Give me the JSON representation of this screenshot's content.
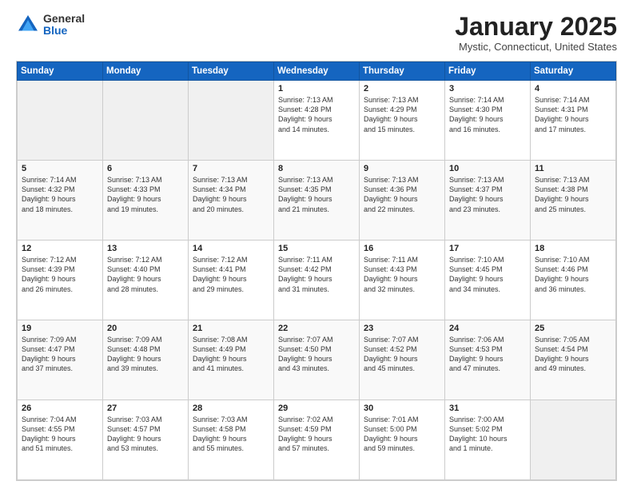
{
  "header": {
    "logo_general": "General",
    "logo_blue": "Blue",
    "month_title": "January 2025",
    "location": "Mystic, Connecticut, United States"
  },
  "days_of_week": [
    "Sunday",
    "Monday",
    "Tuesday",
    "Wednesday",
    "Thursday",
    "Friday",
    "Saturday"
  ],
  "weeks": [
    [
      {
        "day": "",
        "content": ""
      },
      {
        "day": "",
        "content": ""
      },
      {
        "day": "",
        "content": ""
      },
      {
        "day": "1",
        "content": "Sunrise: 7:13 AM\nSunset: 4:28 PM\nDaylight: 9 hours\nand 14 minutes."
      },
      {
        "day": "2",
        "content": "Sunrise: 7:13 AM\nSunset: 4:29 PM\nDaylight: 9 hours\nand 15 minutes."
      },
      {
        "day": "3",
        "content": "Sunrise: 7:14 AM\nSunset: 4:30 PM\nDaylight: 9 hours\nand 16 minutes."
      },
      {
        "day": "4",
        "content": "Sunrise: 7:14 AM\nSunset: 4:31 PM\nDaylight: 9 hours\nand 17 minutes."
      }
    ],
    [
      {
        "day": "5",
        "content": "Sunrise: 7:14 AM\nSunset: 4:32 PM\nDaylight: 9 hours\nand 18 minutes."
      },
      {
        "day": "6",
        "content": "Sunrise: 7:13 AM\nSunset: 4:33 PM\nDaylight: 9 hours\nand 19 minutes."
      },
      {
        "day": "7",
        "content": "Sunrise: 7:13 AM\nSunset: 4:34 PM\nDaylight: 9 hours\nand 20 minutes."
      },
      {
        "day": "8",
        "content": "Sunrise: 7:13 AM\nSunset: 4:35 PM\nDaylight: 9 hours\nand 21 minutes."
      },
      {
        "day": "9",
        "content": "Sunrise: 7:13 AM\nSunset: 4:36 PM\nDaylight: 9 hours\nand 22 minutes."
      },
      {
        "day": "10",
        "content": "Sunrise: 7:13 AM\nSunset: 4:37 PM\nDaylight: 9 hours\nand 23 minutes."
      },
      {
        "day": "11",
        "content": "Sunrise: 7:13 AM\nSunset: 4:38 PM\nDaylight: 9 hours\nand 25 minutes."
      }
    ],
    [
      {
        "day": "12",
        "content": "Sunrise: 7:12 AM\nSunset: 4:39 PM\nDaylight: 9 hours\nand 26 minutes."
      },
      {
        "day": "13",
        "content": "Sunrise: 7:12 AM\nSunset: 4:40 PM\nDaylight: 9 hours\nand 28 minutes."
      },
      {
        "day": "14",
        "content": "Sunrise: 7:12 AM\nSunset: 4:41 PM\nDaylight: 9 hours\nand 29 minutes."
      },
      {
        "day": "15",
        "content": "Sunrise: 7:11 AM\nSunset: 4:42 PM\nDaylight: 9 hours\nand 31 minutes."
      },
      {
        "day": "16",
        "content": "Sunrise: 7:11 AM\nSunset: 4:43 PM\nDaylight: 9 hours\nand 32 minutes."
      },
      {
        "day": "17",
        "content": "Sunrise: 7:10 AM\nSunset: 4:45 PM\nDaylight: 9 hours\nand 34 minutes."
      },
      {
        "day": "18",
        "content": "Sunrise: 7:10 AM\nSunset: 4:46 PM\nDaylight: 9 hours\nand 36 minutes."
      }
    ],
    [
      {
        "day": "19",
        "content": "Sunrise: 7:09 AM\nSunset: 4:47 PM\nDaylight: 9 hours\nand 37 minutes."
      },
      {
        "day": "20",
        "content": "Sunrise: 7:09 AM\nSunset: 4:48 PM\nDaylight: 9 hours\nand 39 minutes."
      },
      {
        "day": "21",
        "content": "Sunrise: 7:08 AM\nSunset: 4:49 PM\nDaylight: 9 hours\nand 41 minutes."
      },
      {
        "day": "22",
        "content": "Sunrise: 7:07 AM\nSunset: 4:50 PM\nDaylight: 9 hours\nand 43 minutes."
      },
      {
        "day": "23",
        "content": "Sunrise: 7:07 AM\nSunset: 4:52 PM\nDaylight: 9 hours\nand 45 minutes."
      },
      {
        "day": "24",
        "content": "Sunrise: 7:06 AM\nSunset: 4:53 PM\nDaylight: 9 hours\nand 47 minutes."
      },
      {
        "day": "25",
        "content": "Sunrise: 7:05 AM\nSunset: 4:54 PM\nDaylight: 9 hours\nand 49 minutes."
      }
    ],
    [
      {
        "day": "26",
        "content": "Sunrise: 7:04 AM\nSunset: 4:55 PM\nDaylight: 9 hours\nand 51 minutes."
      },
      {
        "day": "27",
        "content": "Sunrise: 7:03 AM\nSunset: 4:57 PM\nDaylight: 9 hours\nand 53 minutes."
      },
      {
        "day": "28",
        "content": "Sunrise: 7:03 AM\nSunset: 4:58 PM\nDaylight: 9 hours\nand 55 minutes."
      },
      {
        "day": "29",
        "content": "Sunrise: 7:02 AM\nSunset: 4:59 PM\nDaylight: 9 hours\nand 57 minutes."
      },
      {
        "day": "30",
        "content": "Sunrise: 7:01 AM\nSunset: 5:00 PM\nDaylight: 9 hours\nand 59 minutes."
      },
      {
        "day": "31",
        "content": "Sunrise: 7:00 AM\nSunset: 5:02 PM\nDaylight: 10 hours\nand 1 minute."
      },
      {
        "day": "",
        "content": ""
      }
    ]
  ]
}
